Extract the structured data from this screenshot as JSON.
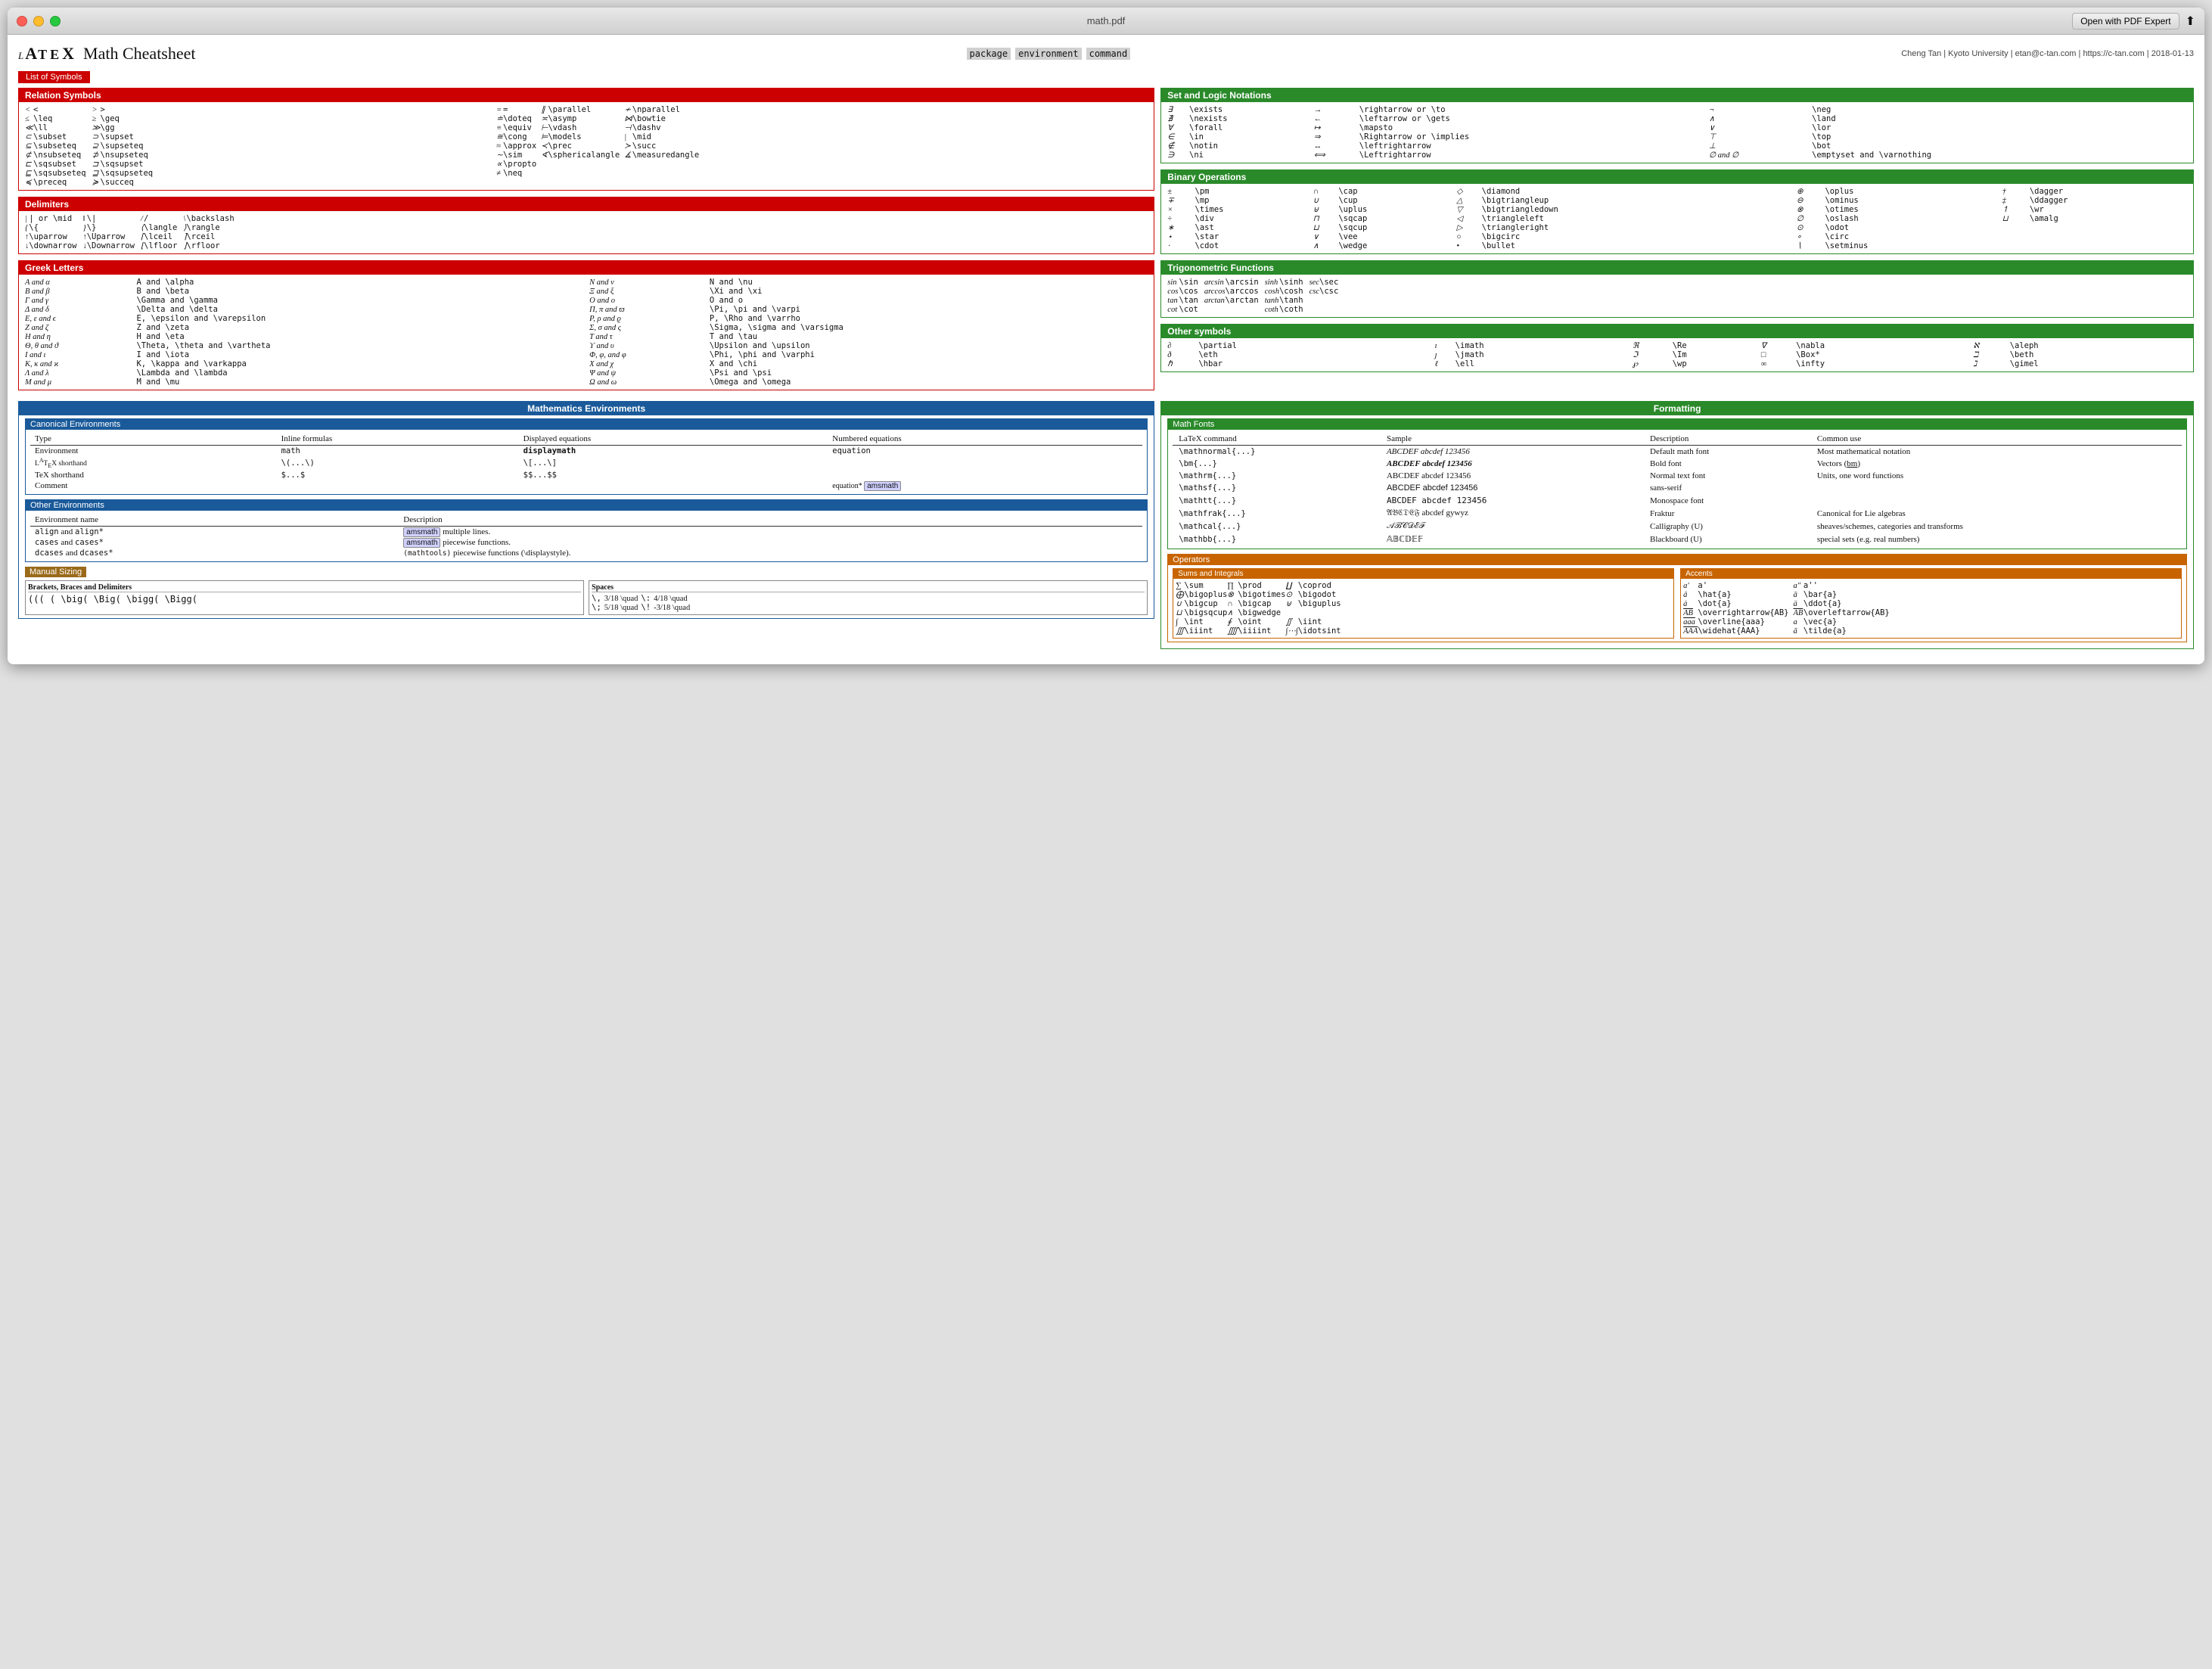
{
  "window": {
    "title": "math.pdf",
    "open_button": "Open with PDF Expert"
  },
  "page": {
    "title": "LaTeX Math Cheatsheet",
    "subtitle_tags": [
      "package",
      "environment",
      "command"
    ],
    "author_info": "Cheng Tan | Kyoto University | etan@c-tan.com | https://c-tan.com | 2018-01-13"
  },
  "list_of_symbols": "List of Symbols",
  "relation_symbols": {
    "header": "Relation Symbols",
    "items": [
      [
        "<",
        "<",
        ">",
        ">"
      ],
      [
        "≤",
        "\\leq",
        "≥",
        "\\geq"
      ],
      [
        "≪",
        "\\ll",
        "≫",
        "\\gg"
      ],
      [
        "⊂",
        "\\subset",
        "⊃",
        "\\supset"
      ],
      [
        "⊆",
        "\\subseteq",
        "⊇",
        "\\supseteq"
      ],
      [
        "⊄",
        "\\nsubseteq",
        "⊅",
        "\\nsupseteq"
      ],
      [
        "⊏",
        "\\sqsubset",
        "⊐",
        "\\sqsupset"
      ],
      [
        "⊑",
        "\\sqsubseteq",
        "⊒",
        "\\sqsupseteq"
      ],
      [
        "≼",
        "\\preceq",
        "≽",
        "\\succeq"
      ]
    ],
    "items2": [
      [
        "=",
        "=",
        "∥",
        "\\parallel",
        "≁",
        "\\nparallel"
      ],
      [
        "≐",
        "\\doteq",
        "≍",
        "\\asymp",
        "⋈",
        "\\bowtie"
      ],
      [
        "≡",
        "\\equiv",
        "⊢",
        "\\vdash",
        "⊣",
        "\\dashv"
      ],
      [
        "≅",
        "\\cong",
        "⊨",
        "\\models",
        "|",
        "\\mid"
      ],
      [
        "≈",
        "\\approx",
        "≺",
        "\\prec",
        "≻",
        "\\succ"
      ],
      [
        "∼",
        "\\sim",
        "≮",
        "\\sphericalangle",
        "∡",
        "\\measuredangle"
      ],
      [
        "∝",
        "\\propto"
      ],
      [
        "≠",
        "\\neq"
      ]
    ]
  },
  "delimiters": {
    "header": "Delimiters",
    "items": [
      [
        "|",
        "| or \\mid",
        "‖",
        "\\|"
      ],
      [
        "{",
        "\\{",
        "}",
        "\\}"
      ],
      [
        "↑",
        "\\uparrow",
        "↑",
        "\\Uparrow"
      ],
      [
        "↓",
        "\\downarrow",
        "↓",
        "\\Downarrow"
      ],
      [
        "/",
        "/",
        "\\",
        "\\backslash"
      ],
      [
        "⟨",
        "\\langle",
        "⟩",
        "\\rangle"
      ],
      [
        "⌈",
        "\\lceil",
        "⌉",
        "\\rceil"
      ],
      [
        "⌊",
        "\\lfloor",
        "⌋",
        "\\rfloor"
      ]
    ]
  },
  "greek_letters": {
    "header": "Greek Letters",
    "items": [
      [
        "A and α",
        "A and \\alpha",
        "N and ν",
        "N and \\nu"
      ],
      [
        "B and β",
        "B and \\beta",
        "Ξ and ξ",
        "\\Xi and \\xi"
      ],
      [
        "Γ and γ",
        "\\Gamma and \\gamma",
        "O and o",
        "O and o"
      ],
      [
        "Δ and δ",
        "\\Delta and \\delta",
        "Π, π and ϖ",
        "\\Pi, \\pi and \\varpi"
      ],
      [
        "E, ε and ϵ",
        "E, \\epsilon and \\varepsilon",
        "P, ρ and ϱ",
        "P, \\Rho and \\varrho"
      ],
      [
        "Z and ζ",
        "Z and \\zeta",
        "Σ, σ and ς",
        "\\Sigma, \\sigma and \\varsigma"
      ],
      [
        "H and η",
        "H and \\eta",
        "T and τ",
        "T and \\tau"
      ],
      [
        "Θ, θ and ϑ",
        "\\Theta, \\theta and \\vartheta",
        "T and υ",
        "\\Upsilon and \\upsilon"
      ],
      [
        "I and ι",
        "I and \\iota",
        "Φ, φ, and φ",
        "\\Phi, \\phi and \\varphi"
      ],
      [
        "K, κ and κ",
        "K, \\kappa and \\varkappa",
        "X and χ",
        "X and \\chi"
      ],
      [
        "Λ and λ",
        "\\Lambda and \\lambda",
        "Ψ and ψ",
        "\\Psi and \\psi"
      ],
      [
        "M and μ",
        "M and \\mu",
        "Ω and ω",
        "\\Omega and \\omega"
      ]
    ]
  },
  "set_logic": {
    "header": "Set and Logic Notations",
    "items": [
      [
        "∃",
        "\\exists",
        "→",
        "\\rightarrow or \\to",
        "¬",
        "\\neg"
      ],
      [
        "∄",
        "\\nexists",
        "←",
        "\\leftarrow or \\gets",
        "∧",
        "\\land"
      ],
      [
        "∀",
        "\\forall",
        "↦",
        "\\mapsto",
        "∨",
        "\\lor"
      ],
      [
        "∈",
        "\\in",
        "⇒",
        "\\Rightarrow or \\implies",
        "⊤",
        "\\top"
      ],
      [
        "∉",
        "\\notin",
        "↔",
        "\\leftrightarrow",
        "⊥",
        "\\bot"
      ],
      [
        "∋",
        "\\ni",
        "⟺",
        "\\Leftrightarrow",
        "∅ and ∅",
        "\\emptyset and \\varnothing"
      ]
    ]
  },
  "binary_ops": {
    "header": "Binary Operations",
    "items": [
      [
        "±",
        "\\pm",
        "∩",
        "\\cap",
        "◇",
        "\\diamond",
        "⊕",
        "\\oplus",
        "†",
        "\\dagger"
      ],
      [
        "∓",
        "\\mp",
        "∪",
        "\\cup",
        "△",
        "\\bigtriangleup",
        "⊖",
        "\\ominus",
        "‡",
        "\\ddagger"
      ],
      [
        "×",
        "\\times",
        "⊎",
        "\\uplus",
        "▽",
        "\\bigtriangledown",
        "⊗",
        "\\otimes",
        "↿",
        "\\wr"
      ],
      [
        "÷",
        "\\div",
        "⊓",
        "\\sqcap",
        "◁",
        "\\triangleleft",
        "∅",
        "\\oslash",
        "⊔",
        "\\amalg"
      ],
      [
        "∗",
        "\\ast",
        "⊔",
        "\\sqcup",
        "▷",
        "\\triangleright",
        "⊙",
        "\\odot"
      ],
      [
        "⋆",
        "\\star",
        "∨",
        "\\vee",
        "○",
        "\\bigcirc",
        "⊚",
        "\\circ"
      ],
      [
        "⋅",
        "\\cdot",
        "∧",
        "\\wedge",
        "•",
        "\\bullet",
        "∖",
        "\\setminus"
      ]
    ]
  },
  "trig": {
    "header": "Trigonometric Functions",
    "items": [
      [
        "sin",
        "\\sin",
        "arcsin",
        "\\arcsin",
        "sinh",
        "\\sinh",
        "sec",
        "\\sec"
      ],
      [
        "cos",
        "\\cos",
        "arccos",
        "\\arccos",
        "cosh",
        "\\cosh",
        "csc",
        "\\csc"
      ],
      [
        "tan",
        "\\tan",
        "arctan",
        "\\arctan",
        "tanh",
        "\\tanh"
      ],
      [
        "cot",
        "\\cot",
        "",
        "",
        "coth",
        "\\coth"
      ]
    ]
  },
  "other_symbols": {
    "header": "Other symbols",
    "items": [
      [
        "∂",
        "\\partial",
        "ı",
        "\\imath",
        "ℜ",
        "\\Re",
        "∇",
        "\\nabla",
        "ℵ",
        "\\aleph"
      ],
      [
        "∂",
        "\\eth",
        "ȷ",
        "\\jmath",
        "ℑ",
        "\\Im",
        "□",
        "\\Box*",
        "ℶ",
        "\\beth"
      ],
      [
        "ℏ",
        "\\hbar",
        "ℓ",
        "\\ell",
        "℘",
        "\\wp",
        "∞",
        "\\infty",
        "ℷ",
        "\\gimel"
      ]
    ]
  },
  "math_envs": {
    "tab": "Mathematics Environments",
    "canonical": {
      "header": "Canonical Environments",
      "cols": [
        "Type",
        "Inline formulas",
        "Displayed equations",
        "Numbered equations"
      ],
      "rows": [
        [
          "Environment",
          "math",
          "displaymath",
          "equation"
        ],
        [
          "LaTeX shorthand",
          "\\(...\\)",
          "\\[...\\]",
          ""
        ],
        [
          "TeX shorthand",
          "$...$",
          "$$...$$",
          ""
        ],
        [
          "Comment",
          "",
          "",
          "equation* (amsmath)"
        ]
      ]
    },
    "other": {
      "header": "Other Environments",
      "cols": [
        "Environment name",
        "Description"
      ],
      "rows": [
        [
          "align and align*",
          "(amsmath) multiple lines."
        ],
        [
          "cases and cases*",
          "(amsmath) piecewise functions."
        ],
        [
          "dcases and dcases*",
          "(mathtools) piecewise functions (\\displaystyle)."
        ]
      ]
    },
    "manual_sizing": {
      "header": "Manual Sizing",
      "brackets": {
        "header": "Brackets, Braces and Delimiters",
        "content": "((( ( \\big( \\Big( \\bigg( \\Bigg("
      },
      "spaces": {
        "header": "Spaces",
        "rows": [
          [
            "\\,",
            "3/18 \\quad",
            "\\:",
            "4/18 \\quad"
          ],
          [
            "\\;",
            "5/18 \\quad",
            "\\!",
            "-3/18 \\quad"
          ]
        ]
      }
    }
  },
  "formatting": {
    "tab": "Formatting",
    "math_fonts": {
      "header": "Math Fonts",
      "cols": [
        "LaTeX command",
        "Sample",
        "Description",
        "Common use"
      ],
      "rows": [
        [
          "\\mathnormal{...}",
          "ABCDEF abcdef 123456",
          "Default math font",
          "Most mathematical notation"
        ],
        [
          "\\bm{...}",
          "ABCDEF abcdef 123456",
          "Bold font",
          "Vectors (bm)"
        ],
        [
          "\\mathrm{...}",
          "ABCDEF abcdef 123456",
          "Normal text font",
          "Units, one word functions"
        ],
        [
          "\\mathsf{...}",
          "ABCDEF abcdef 123456",
          "sans-serif",
          ""
        ],
        [
          "\\mathtt{...}",
          "ABCDEF abcdef 123456",
          "Monospace font",
          ""
        ],
        [
          "\\mathfrak{...}",
          "𝔄𝔅ℭ𝔇𝔈𝔉 abcdef ggwyz",
          "Fraktur",
          "Canonical for Lie algebras"
        ],
        [
          "\\mathcal{...}",
          "𝒜ℬ𝒞𝒟𝒢𝒻",
          "Calligraphy (U)",
          "sheaves/schemes, categories and transforms"
        ],
        [
          "\\mathbb{...}",
          "ABCDEF",
          "Blackboard (U)",
          "special sets (e.g. real numbers)"
        ]
      ]
    },
    "operators": {
      "header": "Operators",
      "sums": {
        "header": "Sums and Integrals",
        "items": [
          [
            "∑",
            "\\sum",
            "∏",
            "\\prod",
            "∐",
            "\\coprod"
          ],
          [
            "⨁",
            "\\bigoplus",
            "⊗",
            "\\bigotimes",
            "⊙",
            "\\bigodot"
          ],
          [
            "∪",
            "\\bigcup",
            "∩",
            "\\bigcap",
            "⊎",
            "\\biguplus"
          ],
          [
            "⊔",
            "\\bigsqcup",
            "∧",
            "\\bigwedge"
          ],
          [
            "∫",
            "\\int",
            "∮",
            "\\oint",
            "∬",
            "\\iint"
          ],
          [
            "∭",
            "\\iiint",
            "⨌",
            "\\iiiint",
            "∫⋯∫",
            "\\idotsint"
          ]
        ]
      },
      "accents": {
        "header": "Accents",
        "items": [
          [
            "a′",
            "a'",
            "a″",
            "a''"
          ],
          [
            "â",
            "\\hat{a}",
            "ā",
            "\\bar{a}"
          ],
          [
            "ȧ",
            "\\dot{a}",
            "ä",
            "\\ddot{a}"
          ],
          [
            "ā",
            "\\overrightarrow{AB}",
            "ā",
            "\\overleftarrow{AB}"
          ],
          [
            "aaa̅",
            "\\overline{aaa}",
            "ā",
            "\\vec{a}"
          ],
          [
            "ÃAA",
            "\\widehat{AAA}",
            "ã",
            "\\tilde{a}"
          ]
        ]
      }
    }
  }
}
